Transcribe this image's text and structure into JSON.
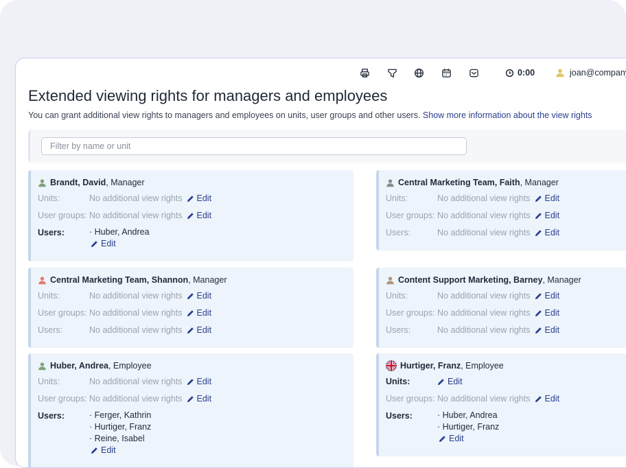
{
  "colors": {
    "accent": "#2a3e8c",
    "card_bg": "#edf4fb",
    "muted": "#9aa3ad"
  },
  "toolbar": {
    "icons": [
      "printer-icon",
      "filter-icon",
      "globe-icon",
      "calendar-icon",
      "inbox-icon"
    ],
    "timer": "0:00",
    "user": "joan@company."
  },
  "page": {
    "title": "Extended viewing rights for managers and employees",
    "intro": "You can grant additional view rights to managers and employees on units, user groups and other users.",
    "more_link": "Show more information about the view rights"
  },
  "filter": {
    "placeholder": "Filter by name or unit"
  },
  "labels": {
    "units": "Units:",
    "user_groups": "User groups:",
    "users": "Users:",
    "no_rights": "No additional view rights",
    "edit": "Edit"
  },
  "cards": [
    {
      "name": "Brandt, David",
      "role": ", Manager",
      "avatar": "green-person",
      "users": [
        "· Huber, Andrea"
      ]
    },
    {
      "name": "Central Marketing Team, Faith",
      "role": ", Manager",
      "avatar": "gray-person",
      "users": []
    },
    {
      "name": "Central Marketing Team, Shannon",
      "role": ", Manager",
      "avatar": "red-person",
      "users": []
    },
    {
      "name": "Content Support Marketing, Barney",
      "role": ", Manager",
      "avatar": "brown-person",
      "users": []
    },
    {
      "name": "Huber, Andrea",
      "role": ", Employee",
      "avatar": "green-person",
      "users": [
        "· Ferger, Kathrin",
        "· Hurtiger, Franz",
        "· Reine, Isabel"
      ]
    },
    {
      "name": "Hurtiger, Franz",
      "role": ", Employee",
      "avatar": "uk-flag",
      "units_has": true,
      "users": [
        "· Huber, Andrea",
        "· Hurtiger, Franz"
      ]
    }
  ]
}
